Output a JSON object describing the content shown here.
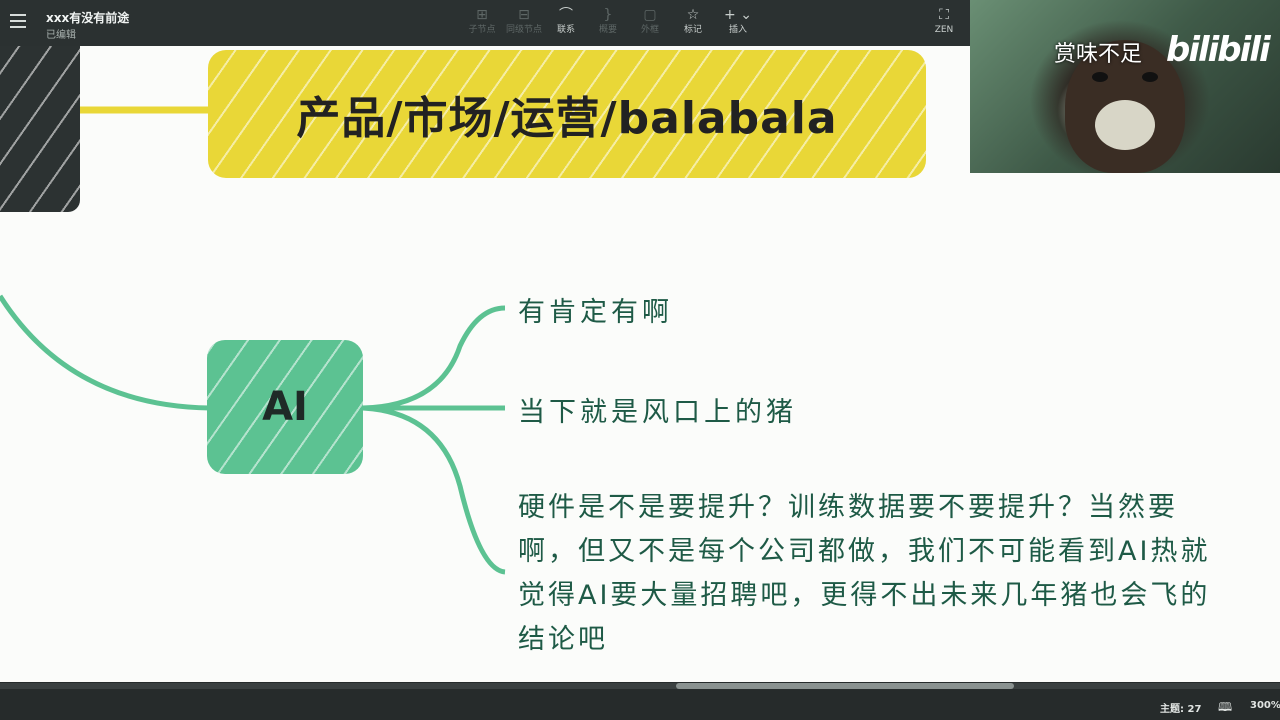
{
  "app": {
    "doc_title": "xxx有没有前途",
    "doc_status": "已编辑"
  },
  "toolbar": {
    "items": [
      {
        "label": "子节点",
        "icon": "child-topic-icon",
        "enabled": false
      },
      {
        "label": "同级节点",
        "icon": "sibling-topic-icon",
        "enabled": false
      },
      {
        "label": "联系",
        "icon": "relationship-icon",
        "enabled": true
      },
      {
        "label": "概要",
        "icon": "summary-icon",
        "enabled": false
      },
      {
        "label": "外框",
        "icon": "boundary-icon",
        "enabled": false
      },
      {
        "label": "标记",
        "icon": "star-icon",
        "enabled": true
      },
      {
        "label": "插入",
        "icon": "plus-icon",
        "enabled": true
      }
    ],
    "zen_label": "ZEN"
  },
  "mindmap": {
    "top_node_text": "产品/市场/运营/balabala",
    "ai_node_text": "AI",
    "branches": [
      "有肯定有啊",
      "当下就是风口上的猪",
      "硬件是不是要提升？训练数据要不要提升？当然要"
    ],
    "long_branch_lines": [
      "硬件是不是要提升？训练数据要不要提升？当然要",
      "啊，但又不是每个公司都做，我们不可能看到AI热就",
      "觉得AI要大量招聘吧，更得不出未来几年猪也会飞的",
      "结论吧"
    ],
    "colors": {
      "top_node": "#e9d737",
      "ai_node": "#5cc292",
      "dark_node": "#2c3232",
      "branch_line": "#5cc292",
      "branch_text": "#1e5a46"
    }
  },
  "video_overlay": {
    "caption": "赏味不足",
    "logo_text": "bilibili"
  },
  "statusbar": {
    "topic_count": "主题: 27",
    "zoom": "300%"
  }
}
